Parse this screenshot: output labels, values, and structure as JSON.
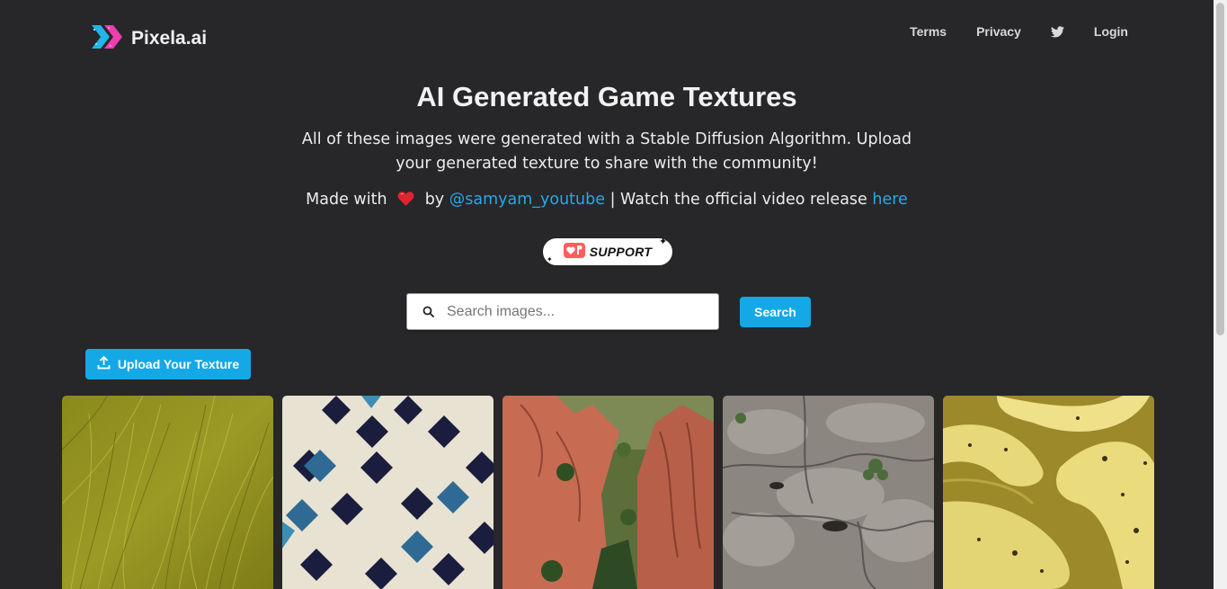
{
  "nav": {
    "brand": "Pixela.ai",
    "links": {
      "terms": "Terms",
      "privacy": "Privacy",
      "login": "Login"
    },
    "twitter_icon": "twitter-icon"
  },
  "hero": {
    "title": "AI Generated Game Textures",
    "description": "All of these images were generated with a Stable Diffusion Algorithm. Upload your generated texture to share with the community!",
    "made_with": "Made with",
    "by": "by",
    "author_link": "@samyam_youtube",
    "watch_text": "| Watch the official video release",
    "here_link": "here"
  },
  "support_button": {
    "label": "SUPPORT",
    "icon": "ko-fi-heart-icon"
  },
  "search": {
    "placeholder": "Search images...",
    "value": "",
    "button_label": "Search"
  },
  "upload": {
    "label": "Upload Your Texture",
    "icon": "upload-icon"
  },
  "gallery": [
    {
      "name": "grass-texture"
    },
    {
      "name": "diamond-tiles-texture"
    },
    {
      "name": "red-rock-canyon-texture"
    },
    {
      "name": "rock-cliff-texture"
    },
    {
      "name": "banana-texture"
    }
  ],
  "colors": {
    "background": "#272629",
    "accent": "#14a8e6",
    "link": "#27a9e7",
    "heart": "#e0242f"
  }
}
